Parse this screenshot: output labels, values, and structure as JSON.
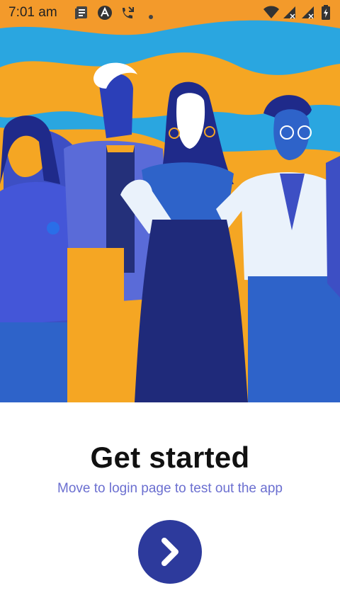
{
  "status_bar": {
    "time": "7:01 am",
    "icons": [
      "notes-icon",
      "app-a-icon",
      "call-forward-icon",
      "dot-icon",
      "wifi-icon",
      "signal-icon",
      "signal-icon-2",
      "battery-icon"
    ]
  },
  "onboarding": {
    "title": "Get started",
    "subtitle": "Move to login page to test out the app",
    "next_button_icon": "chevron-right-icon"
  },
  "colors": {
    "sky": "#2aa6e0",
    "sand": "#f5a623",
    "accent": "#2d3a9c",
    "subtitle": "#6b6fd0"
  }
}
